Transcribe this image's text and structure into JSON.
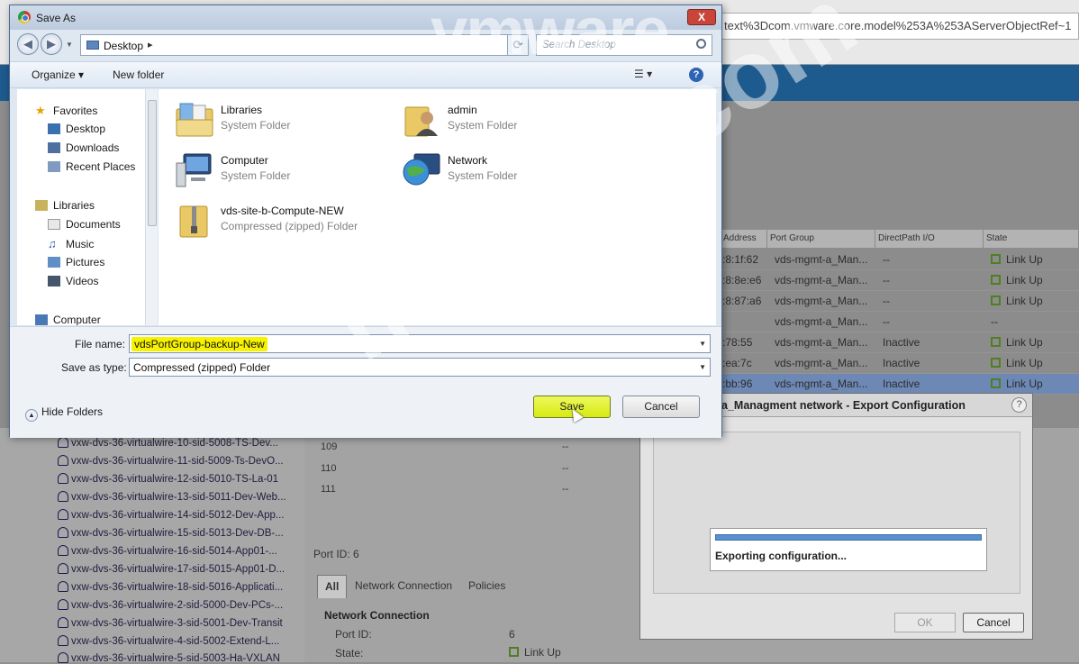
{
  "background": {
    "address_text": "text%3Dcom.vmware.core.model%253A%253AServerObjectRef~1",
    "table": {
      "columns": [
        "Address",
        "Port Group",
        "DirectPath I/O",
        "State"
      ],
      "rows": [
        {
          "address": ":8:1f:62",
          "port_group": "vds-mgmt-a_Man...",
          "directpath": "--",
          "state": "Link Up"
        },
        {
          "address": ":8:8e:e6",
          "port_group": "vds-mgmt-a_Man...",
          "directpath": "--",
          "state": "Link Up"
        },
        {
          "address": ":8:87:a6",
          "port_group": "vds-mgmt-a_Man...",
          "directpath": "--",
          "state": "Link Up"
        },
        {
          "address": "",
          "port_group": "vds-mgmt-a_Man...",
          "directpath": "--",
          "state": "--"
        },
        {
          "address": ":78:55",
          "port_group": "vds-mgmt-a_Man...",
          "directpath": "Inactive",
          "state": "Link Up"
        },
        {
          "address": ":ea:7c",
          "port_group": "vds-mgmt-a_Man...",
          "directpath": "Inactive",
          "state": "Link Up"
        },
        {
          "address": ":bb:96",
          "port_group": "vds-mgmt-a_Man...",
          "directpath": "Inactive",
          "state": "Link Up"
        }
      ]
    },
    "port_numbers": [
      "109",
      "110",
      "111"
    ],
    "tree_items": [
      "vxw-dvs-36-virtualwire-10-sid-5008-TS-Dev...",
      "vxw-dvs-36-virtualwire-11-sid-5009-Ts-DevO...",
      "vxw-dvs-36-virtualwire-12-sid-5010-TS-La-01",
      "vxw-dvs-36-virtualwire-13-sid-5011-Dev-Web...",
      "vxw-dvs-36-virtualwire-14-sid-5012-Dev-App...",
      "vxw-dvs-36-virtualwire-15-sid-5013-Dev-DB-...",
      "vxw-dvs-36-virtualwire-16-sid-5014-App01-...",
      "vxw-dvs-36-virtualwire-17-sid-5015-App01-D...",
      "vxw-dvs-36-virtualwire-18-sid-5016-Applicati...",
      "vxw-dvs-36-virtualwire-2-sid-5000-Dev-PCs-...",
      "vxw-dvs-36-virtualwire-3-sid-5001-Dev-Transit",
      "vxw-dvs-36-virtualwire-4-sid-5002-Extend-L...",
      "vxw-dvs-36-virtualwire-5-sid-5003-Ha-VXLAN"
    ],
    "port_id_header": "Port ID: 6",
    "tabs": [
      "All",
      "Network Connection",
      "Policies"
    ],
    "network_connection_title": "Network Connection",
    "port_id_label": "Port ID:",
    "port_id_value": "6",
    "state_label": "State:",
    "state_value": "Link Up"
  },
  "export_dialog": {
    "title": "a_Managment network - Export Configuration",
    "help": "?",
    "status": "Exporting configuration...",
    "progress": 1.0,
    "ok_label": "OK",
    "cancel_label": "Cancel"
  },
  "save_dialog": {
    "title": "Save As",
    "close_label": "X",
    "path": "Desktop",
    "search_placeholder": "Search Desktop",
    "toolbar": {
      "organize": "Organize ▾",
      "new_folder": "New folder"
    },
    "nav": {
      "favorites": "Favorites",
      "desktop": "Desktop",
      "downloads": "Downloads",
      "recent_places": "Recent Places",
      "libraries": "Libraries",
      "documents": "Documents",
      "music": "Music",
      "pictures": "Pictures",
      "videos": "Videos",
      "computer": "Computer"
    },
    "files": [
      {
        "name": "Libraries",
        "type": "System Folder"
      },
      {
        "name": "admin",
        "type": "System Folder"
      },
      {
        "name": "Computer",
        "type": "System Folder"
      },
      {
        "name": "Network",
        "type": "System Folder"
      },
      {
        "name": "vds-site-b-Compute-NEW",
        "type": "Compressed (zipped) Folder"
      }
    ],
    "file_name_label": "File name:",
    "file_name_value": "vdsPortGroup-backup-New",
    "save_type_label": "Save as type:",
    "save_type_value": "Compressed (zipped) Folder",
    "hide_folders": "Hide Folders",
    "save_label": "Save",
    "cancel_label": "Cancel"
  },
  "watermarks": {
    "brand": "vmware",
    "site": "nshiken.com"
  },
  "colors": {
    "highlight": "#f6f200",
    "save_button": "#d6ea12",
    "vm_header": "#1d5a8e"
  }
}
